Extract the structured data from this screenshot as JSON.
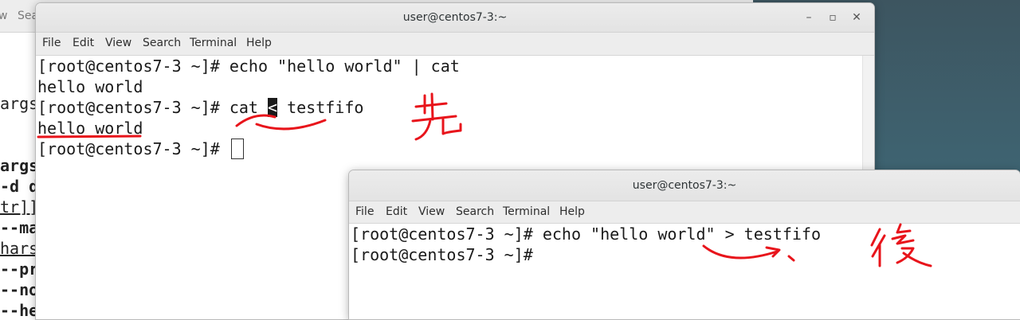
{
  "background_window": {
    "menu_fragments": [
      "w",
      "Sea"
    ],
    "lines": [
      {
        "text": "args",
        "style": "normal"
      },
      {
        "text": "args",
        "style": "bold"
      },
      {
        "text": "-d d",
        "style": "bold"
      },
      {
        "text": "tr]]",
        "style": "underline"
      },
      {
        "text": "--ma",
        "style": "bold"
      },
      {
        "text": "hars",
        "style": "underline"
      },
      {
        "text": "--pr",
        "style": "bold"
      },
      {
        "text": "--no",
        "style": "bold"
      },
      {
        "text": "--he",
        "style": "bold"
      }
    ]
  },
  "terminal_main": {
    "title": "user@centos7-3:~",
    "menu": [
      "File",
      "Edit",
      "View",
      "Search",
      "Terminal",
      "Help"
    ],
    "lines": {
      "l1": "[root@centos7-3 ~]# echo \"hello world\" | cat",
      "l2": "hello world",
      "l3_prompt": "[root@centos7-3 ~]# cat ",
      "l3_highlight": "<",
      "l3_rest": " testfifo",
      "l4": "hello world",
      "l5_prompt": "[root@centos7-3 ~]# "
    }
  },
  "terminal_second": {
    "title": "user@centos7-3:~",
    "menu": [
      "File",
      "Edit",
      "View",
      "Search",
      "Terminal",
      "Help"
    ],
    "lines": {
      "l1": "[root@centos7-3 ~]# echo \"hello world\" > testfifo",
      "l2": "[root@centos7-3 ~]#"
    }
  },
  "annotations": {
    "color": "#e8141b",
    "first_note": "先",
    "second_note": "後"
  },
  "window_buttons": {
    "minimize": "–",
    "maximize": "▫",
    "close": "✕"
  }
}
